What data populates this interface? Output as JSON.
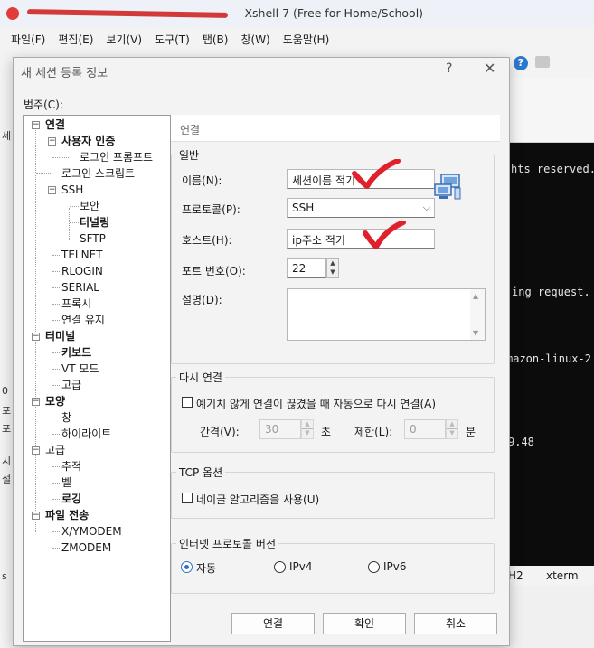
{
  "app": {
    "title": "- Xshell 7 (Free for Home/School)",
    "menu": [
      "파일(F)",
      "편집(E)",
      "보기(V)",
      "도구(T)",
      "탭(B)",
      "창(W)",
      "도움말(H)"
    ],
    "left_strip_letters": [
      "세",
      "0",
      "포",
      "포",
      "시",
      "설",
      "s"
    ],
    "terminal_lines": [
      "hts reserved.",
      "ing request.",
      "mazon-linux-2",
      "9.48"
    ],
    "status": [
      "H2",
      "xterm"
    ]
  },
  "dialog": {
    "title": "새 세션 등록 정보",
    "help_label": "?",
    "close_label": "✕",
    "category_label": "범주(C):",
    "header": "연결",
    "tree": [
      {
        "label": "연결",
        "bold": true
      },
      {
        "label": "사용자 인증",
        "bold": true
      },
      {
        "label": "로그인 프롬프트",
        "bold": false
      },
      {
        "label": "로그인 스크립트",
        "bold": false
      },
      {
        "label": "SSH",
        "bold": false
      },
      {
        "label": "보안",
        "bold": false
      },
      {
        "label": "터널링",
        "bold": true
      },
      {
        "label": "SFTP",
        "bold": false
      },
      {
        "label": "TELNET",
        "bold": false
      },
      {
        "label": "RLOGIN",
        "bold": false
      },
      {
        "label": "SERIAL",
        "bold": false
      },
      {
        "label": "프록시",
        "bold": false
      },
      {
        "label": "연결 유지",
        "bold": false
      },
      {
        "label": "터미널",
        "bold": true
      },
      {
        "label": "키보드",
        "bold": true
      },
      {
        "label": "VT 모드",
        "bold": false
      },
      {
        "label": "고급",
        "bold": false
      },
      {
        "label": "모양",
        "bold": true
      },
      {
        "label": "창",
        "bold": false
      },
      {
        "label": "하이라이트",
        "bold": false
      },
      {
        "label": "고급",
        "bold": false
      },
      {
        "label": "추적",
        "bold": false
      },
      {
        "label": "벨",
        "bold": false
      },
      {
        "label": "로깅",
        "bold": true
      },
      {
        "label": "파일 전송",
        "bold": true
      },
      {
        "label": "X/YMODEM",
        "bold": false
      },
      {
        "label": "ZMODEM",
        "bold": false
      }
    ],
    "general": {
      "title": "일반",
      "name_label": "이름(N):",
      "name_value": "세션이름 적기",
      "protocol_label": "프로토콜(P):",
      "protocol_value": "SSH",
      "host_label": "호스트(H):",
      "host_value": "ip주소 적기",
      "port_label": "포트 번호(O):",
      "port_value": "22",
      "desc_label": "설명(D):",
      "desc_value": ""
    },
    "reconnect": {
      "title": "다시 연결",
      "checkbox_label": "예기치 않게 연결이 끊겼을 때 자동으로 다시 연결(A)",
      "interval_label": "간격(V):",
      "interval_value": "30",
      "interval_unit": "초",
      "limit_label": "제한(L):",
      "limit_value": "0",
      "limit_unit": "분"
    },
    "tcp": {
      "title": "TCP 옵션",
      "checkbox_label": "네이글 알고리즘을 사용(U)"
    },
    "ipver": {
      "title": "인터넷 프로토콜 버전",
      "options": [
        "자동",
        "IPv4",
        "IPv6"
      ],
      "selected": "자동"
    },
    "buttons": {
      "connect": "연결",
      "ok": "확인",
      "cancel": "취소"
    },
    "accent_color": "#e0202a"
  }
}
